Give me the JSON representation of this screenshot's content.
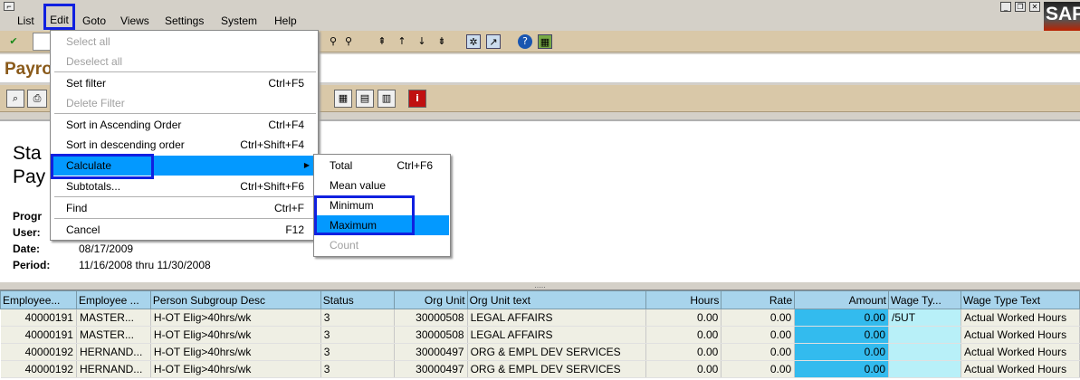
{
  "menubar": {
    "items": [
      "List",
      "Edit",
      "Goto",
      "Views",
      "Settings",
      "System",
      "Help"
    ],
    "logo": "SAP"
  },
  "title": "Payroll",
  "header": {
    "line1": "Sta",
    "line2": "Pay",
    "labels": [
      "Progr",
      "User:",
      "Date:",
      "Period:"
    ],
    "date": "08/17/2009",
    "period": "11/16/2008 thru 11/30/2008"
  },
  "edit_menu": {
    "items": [
      {
        "label": "Select all",
        "shortcut": "",
        "disabled": true
      },
      {
        "label": "Deselect all",
        "shortcut": "",
        "disabled": true
      },
      {
        "label": "Set filter",
        "shortcut": "Ctrl+F5",
        "disabled": false
      },
      {
        "label": "Delete Filter",
        "shortcut": "",
        "disabled": true
      },
      {
        "label": "Sort in Ascending Order",
        "shortcut": "Ctrl+F4",
        "disabled": false
      },
      {
        "label": "Sort in descending order",
        "shortcut": "Ctrl+Shift+F4",
        "disabled": false
      },
      {
        "label": "Calculate",
        "shortcut": "",
        "disabled": false
      },
      {
        "label": "Subtotals...",
        "shortcut": "Ctrl+Shift+F6",
        "disabled": false
      },
      {
        "label": "Find",
        "shortcut": "Ctrl+F",
        "disabled": false
      },
      {
        "label": "Cancel",
        "shortcut": "F12",
        "disabled": false
      }
    ]
  },
  "calculate_submenu": {
    "items": [
      {
        "label": "Total",
        "shortcut": "Ctrl+F6"
      },
      {
        "label": "Mean value",
        "shortcut": ""
      },
      {
        "label": "Minimum",
        "shortcut": ""
      },
      {
        "label": "Maximum",
        "shortcut": ""
      },
      {
        "label": "Count",
        "shortcut": ""
      }
    ]
  },
  "grid": {
    "columns": [
      "Employee...",
      "Employee ...",
      "Person Subgroup Desc",
      "Status",
      "Org Unit",
      "Org Unit text",
      "Hours",
      "Rate",
      "Amount",
      "Wage Ty...",
      "Wage Type Text"
    ],
    "rows": [
      [
        "40000191",
        "MASTER...",
        "H-OT Elig>40hrs/wk",
        "3",
        "30000508",
        "LEGAL AFFAIRS",
        "0.00",
        "0.00",
        "0.00",
        "/5UT",
        "Actual Worked Hours"
      ],
      [
        "40000191",
        "MASTER...",
        "H-OT Elig>40hrs/wk",
        "3",
        "30000508",
        "LEGAL AFFAIRS",
        "0.00",
        "0.00",
        "0.00",
        "",
        "Actual Worked Hours"
      ],
      [
        "40000192",
        "HERNAND...",
        "H-OT Elig>40hrs/wk",
        "3",
        "30000497",
        "ORG & EMPL DEV SERVICES",
        "0.00",
        "0.00",
        "0.00",
        "",
        "Actual Worked Hours"
      ],
      [
        "40000192",
        "HERNAND...",
        "H-OT Elig>40hrs/wk",
        "3",
        "30000497",
        "ORG & EMPL DEV SERVICES",
        "0.00",
        "0.00",
        "0.00",
        "",
        "Actual Worked Hours"
      ]
    ]
  }
}
